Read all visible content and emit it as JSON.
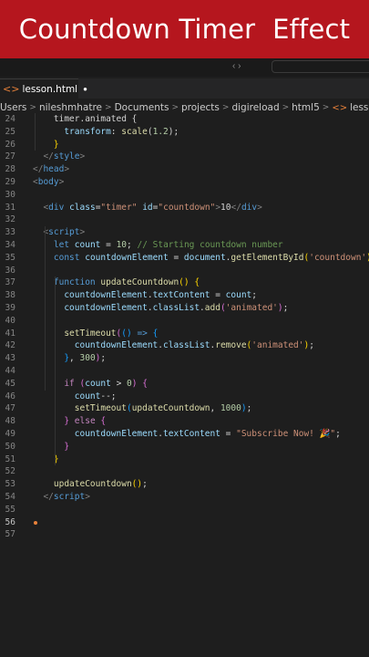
{
  "banner": {
    "title": "Countdown Timer  Effect"
  },
  "tabs": [
    {
      "label": "lesson.html",
      "icon": "html-file-icon",
      "modified": true
    }
  ],
  "breadcrumb": {
    "items": [
      "Users",
      "nileshmhatre",
      "Documents",
      "projects",
      "digireload",
      "html5",
      "lesson.html"
    ],
    "separator": ">",
    "more": "•••"
  },
  "editor": {
    "active_line": 56,
    "lines": [
      {
        "n": "24",
        "indent": 4,
        "tokens": [
          [
            "t-pun",
            "timer.animated {"
          ]
        ]
      },
      {
        "n": "25",
        "indent": 6,
        "tokens": [
          [
            "t-attr",
            "transform"
          ],
          [
            "t-pun",
            ": "
          ],
          [
            "t-fn",
            "scale"
          ],
          [
            "t-pun",
            "("
          ],
          [
            "t-num",
            "1.2"
          ],
          [
            "t-pun",
            ");"
          ]
        ]
      },
      {
        "n": "26",
        "indent": 4,
        "tokens": [
          [
            "t-br1",
            "}"
          ]
        ]
      },
      {
        "n": "27",
        "indent": 2,
        "tokens": [
          [
            "t-gray",
            "</"
          ],
          [
            "t-tag",
            "style"
          ],
          [
            "t-gray",
            ">"
          ]
        ]
      },
      {
        "n": "28",
        "indent": 0,
        "tokens": [
          [
            "t-gray",
            "</"
          ],
          [
            "t-tag",
            "head"
          ],
          [
            "t-gray",
            ">"
          ]
        ]
      },
      {
        "n": "29",
        "indent": 0,
        "tokens": [
          [
            "t-gray",
            "<"
          ],
          [
            "t-tag",
            "body"
          ],
          [
            "t-gray",
            ">"
          ]
        ]
      },
      {
        "n": "30",
        "indent": 0,
        "tokens": []
      },
      {
        "n": "31",
        "indent": 2,
        "tokens": [
          [
            "t-gray",
            "<"
          ],
          [
            "t-tag",
            "div"
          ],
          [
            "t-pun",
            " "
          ],
          [
            "t-attr",
            "class"
          ],
          [
            "t-pun",
            "="
          ],
          [
            "t-str",
            "\"timer\""
          ],
          [
            "t-pun",
            " "
          ],
          [
            "t-attr",
            "id"
          ],
          [
            "t-pun",
            "="
          ],
          [
            "t-str",
            "\"countdown\""
          ],
          [
            "t-gray",
            ">"
          ],
          [
            "t-pun",
            "10"
          ],
          [
            "t-gray",
            "</"
          ],
          [
            "t-tag",
            "div"
          ],
          [
            "t-gray",
            ">"
          ]
        ]
      },
      {
        "n": "32",
        "indent": 0,
        "tokens": []
      },
      {
        "n": "33",
        "indent": 2,
        "tokens": [
          [
            "t-gray",
            "<"
          ],
          [
            "t-tag",
            "script"
          ],
          [
            "t-gray",
            ">"
          ]
        ]
      },
      {
        "n": "34",
        "indent": 4,
        "tokens": [
          [
            "t-kw",
            "let"
          ],
          [
            "t-pun",
            " "
          ],
          [
            "t-var",
            "count"
          ],
          [
            "t-pun",
            " = "
          ],
          [
            "t-num",
            "10"
          ],
          [
            "t-pun",
            "; "
          ],
          [
            "t-cm",
            "// Starting countdown number"
          ]
        ]
      },
      {
        "n": "35",
        "indent": 4,
        "tokens": [
          [
            "t-kw",
            "const"
          ],
          [
            "t-pun",
            " "
          ],
          [
            "t-var",
            "countdownElement"
          ],
          [
            "t-pun",
            " = "
          ],
          [
            "t-var",
            "document"
          ],
          [
            "t-pun",
            "."
          ],
          [
            "t-fn",
            "getElementById"
          ],
          [
            "t-br1",
            "("
          ],
          [
            "t-str",
            "'countdown'"
          ],
          [
            "t-br1",
            ")"
          ],
          [
            "t-pun",
            ";"
          ]
        ]
      },
      {
        "n": "36",
        "indent": 0,
        "tokens": []
      },
      {
        "n": "37",
        "indent": 4,
        "tokens": [
          [
            "t-kw",
            "function"
          ],
          [
            "t-pun",
            " "
          ],
          [
            "t-fn",
            "updateCountdown"
          ],
          [
            "t-br1",
            "()"
          ],
          [
            "t-pun",
            " "
          ],
          [
            "t-br1",
            "{"
          ]
        ]
      },
      {
        "n": "38",
        "indent": 6,
        "tokens": [
          [
            "t-var",
            "countdownElement"
          ],
          [
            "t-pun",
            "."
          ],
          [
            "t-var",
            "textContent"
          ],
          [
            "t-pun",
            " = "
          ],
          [
            "t-var",
            "count"
          ],
          [
            "t-pun",
            ";"
          ]
        ]
      },
      {
        "n": "39",
        "indent": 6,
        "tokens": [
          [
            "t-var",
            "countdownElement"
          ],
          [
            "t-pun",
            "."
          ],
          [
            "t-var",
            "classList"
          ],
          [
            "t-pun",
            "."
          ],
          [
            "t-fn",
            "add"
          ],
          [
            "t-br2",
            "("
          ],
          [
            "t-str",
            "'animated'"
          ],
          [
            "t-br2",
            ")"
          ],
          [
            "t-pun",
            ";"
          ]
        ]
      },
      {
        "n": "40",
        "indent": 0,
        "tokens": []
      },
      {
        "n": "41",
        "indent": 6,
        "tokens": [
          [
            "t-fn",
            "setTimeout"
          ],
          [
            "t-br2",
            "("
          ],
          [
            "t-br3",
            "()"
          ],
          [
            "t-pun",
            " "
          ],
          [
            "t-kw",
            "=>"
          ],
          [
            "t-pun",
            " "
          ],
          [
            "t-br3",
            "{"
          ]
        ]
      },
      {
        "n": "42",
        "indent": 8,
        "tokens": [
          [
            "t-var",
            "countdownElement"
          ],
          [
            "t-pun",
            "."
          ],
          [
            "t-var",
            "classList"
          ],
          [
            "t-pun",
            "."
          ],
          [
            "t-fn",
            "remove"
          ],
          [
            "t-br1",
            "("
          ],
          [
            "t-str",
            "'animated'"
          ],
          [
            "t-br1",
            ")"
          ],
          [
            "t-pun",
            ";"
          ]
        ]
      },
      {
        "n": "43",
        "indent": 6,
        "tokens": [
          [
            "t-br3",
            "}"
          ],
          [
            "t-pun",
            ", "
          ],
          [
            "t-num",
            "300"
          ],
          [
            "t-br2",
            ")"
          ],
          [
            "t-pun",
            ";"
          ]
        ]
      },
      {
        "n": "44",
        "indent": 0,
        "tokens": []
      },
      {
        "n": "45",
        "indent": 6,
        "tokens": [
          [
            "t-ctl",
            "if"
          ],
          [
            "t-pun",
            " "
          ],
          [
            "t-br2",
            "("
          ],
          [
            "t-var",
            "count"
          ],
          [
            "t-pun",
            " > "
          ],
          [
            "t-num",
            "0"
          ],
          [
            "t-br2",
            ")"
          ],
          [
            "t-pun",
            " "
          ],
          [
            "t-br2",
            "{"
          ]
        ]
      },
      {
        "n": "46",
        "indent": 8,
        "tokens": [
          [
            "t-var",
            "count"
          ],
          [
            "t-pun",
            "--;"
          ]
        ]
      },
      {
        "n": "47",
        "indent": 8,
        "tokens": [
          [
            "t-fn",
            "setTimeout"
          ],
          [
            "t-br3",
            "("
          ],
          [
            "t-fn",
            "updateCountdown"
          ],
          [
            "t-pun",
            ", "
          ],
          [
            "t-num",
            "1000"
          ],
          [
            "t-br3",
            ")"
          ],
          [
            "t-pun",
            ";"
          ]
        ]
      },
      {
        "n": "48",
        "indent": 6,
        "tokens": [
          [
            "t-br2",
            "}"
          ],
          [
            "t-pun",
            " "
          ],
          [
            "t-ctl",
            "else"
          ],
          [
            "t-pun",
            " "
          ],
          [
            "t-br2",
            "{"
          ]
        ]
      },
      {
        "n": "49",
        "indent": 8,
        "tokens": [
          [
            "t-var",
            "countdownElement"
          ],
          [
            "t-pun",
            "."
          ],
          [
            "t-var",
            "textContent"
          ],
          [
            "t-pun",
            " = "
          ],
          [
            "t-str",
            "\"Subscribe Now! 🎉\""
          ],
          [
            "t-pun",
            ";"
          ]
        ]
      },
      {
        "n": "50",
        "indent": 6,
        "tokens": [
          [
            "t-br2",
            "}"
          ]
        ]
      },
      {
        "n": "51",
        "indent": 4,
        "tokens": [
          [
            "t-br1",
            "}"
          ]
        ]
      },
      {
        "n": "52",
        "indent": 0,
        "tokens": []
      },
      {
        "n": "53",
        "indent": 4,
        "tokens": [
          [
            "t-fn",
            "updateCountdown"
          ],
          [
            "t-br1",
            "()"
          ],
          [
            "t-pun",
            ";"
          ]
        ]
      },
      {
        "n": "54",
        "indent": 2,
        "tokens": [
          [
            "t-gray",
            "</"
          ],
          [
            "t-tag",
            "script"
          ],
          [
            "t-gray",
            ">"
          ]
        ]
      },
      {
        "n": "55",
        "indent": 0,
        "tokens": []
      },
      {
        "n": "56",
        "indent": 0,
        "tokens": []
      },
      {
        "n": "57",
        "indent": 0,
        "tokens": []
      }
    ]
  },
  "colors": {
    "banner": "#b5161e",
    "editor_bg": "#1e1e1e",
    "cursor": "#e8813a"
  }
}
